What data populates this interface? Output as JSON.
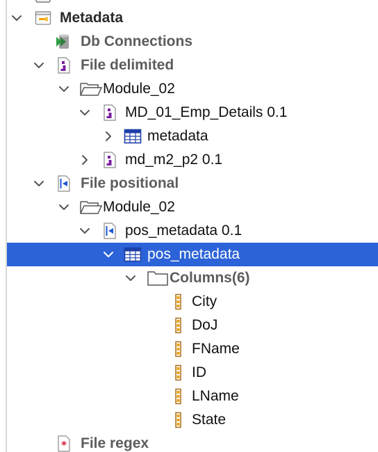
{
  "tree": {
    "rows": [
      {
        "label": "Metadata",
        "bold": true,
        "gray": false,
        "icon": "metadata-folder-icon",
        "expanded": true
      },
      {
        "label": "Db Connections",
        "bold": true,
        "gray": true,
        "icon": "db-connections-icon",
        "expanded": null
      },
      {
        "label": "File delimited",
        "bold": true,
        "gray": true,
        "icon": "file-delimited-icon",
        "expanded": true
      },
      {
        "label": "Module_02",
        "bold": false,
        "gray": false,
        "icon": "folder-open-icon",
        "expanded": true
      },
      {
        "label": "MD_01_Emp_Details 0.1",
        "bold": false,
        "gray": false,
        "icon": "file-delimited-icon",
        "expanded": true
      },
      {
        "label": "metadata",
        "bold": false,
        "gray": false,
        "icon": "table-icon",
        "expanded": false
      },
      {
        "label": "md_m2_p2 0.1",
        "bold": false,
        "gray": false,
        "icon": "file-delimited-icon",
        "expanded": false
      },
      {
        "label": "File positional",
        "bold": true,
        "gray": true,
        "icon": "file-positional-icon",
        "expanded": true
      },
      {
        "label": "Module_02",
        "bold": false,
        "gray": false,
        "icon": "folder-open-icon",
        "expanded": true
      },
      {
        "label": "pos_metadata 0.1",
        "bold": false,
        "gray": false,
        "icon": "file-positional-icon",
        "expanded": true
      },
      {
        "label": "pos_metadata",
        "bold": false,
        "gray": false,
        "icon": "table-icon",
        "expanded": true,
        "selected": true
      },
      {
        "label": "Columns(6)",
        "bold": true,
        "gray": true,
        "icon": "folder-icon",
        "expanded": true
      },
      {
        "label": "City",
        "bold": false,
        "gray": false,
        "icon": "column-icon",
        "expanded": null
      },
      {
        "label": "DoJ",
        "bold": false,
        "gray": false,
        "icon": "column-icon",
        "expanded": null
      },
      {
        "label": "FName",
        "bold": false,
        "gray": false,
        "icon": "column-icon",
        "expanded": null
      },
      {
        "label": "ID",
        "bold": false,
        "gray": false,
        "icon": "column-icon",
        "expanded": null
      },
      {
        "label": "LName",
        "bold": false,
        "gray": false,
        "icon": "column-icon",
        "expanded": null
      },
      {
        "label": "State",
        "bold": false,
        "gray": false,
        "icon": "column-icon",
        "expanded": null
      },
      {
        "label": "File regex",
        "bold": true,
        "gray": true,
        "icon": "file-regex-icon",
        "expanded": null
      }
    ]
  }
}
